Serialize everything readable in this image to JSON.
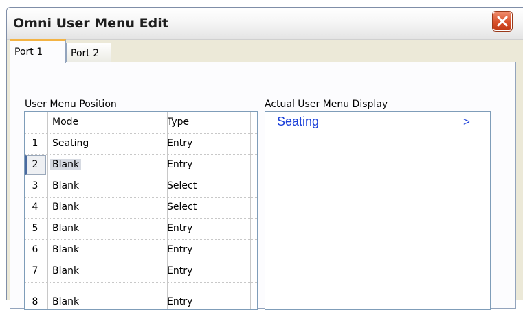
{
  "window": {
    "title": "Omni User Menu Edit",
    "close_icon": "close-x-icon"
  },
  "tabs": [
    {
      "label": "Port 1",
      "active": true
    },
    {
      "label": "Port 2",
      "active": false
    }
  ],
  "left_panel": {
    "label": "User Menu Position",
    "columns": {
      "mode": "Mode",
      "type": "Type"
    },
    "rows": [
      {
        "num": "1",
        "mode": "Seating",
        "type": "Entry"
      },
      {
        "num": "2",
        "mode": "Blank",
        "type": "Entry",
        "selected": true
      },
      {
        "num": "3",
        "mode": "Blank",
        "type": "Select"
      },
      {
        "num": "4",
        "mode": "Blank",
        "type": "Select"
      },
      {
        "num": "5",
        "mode": "Blank",
        "type": "Entry"
      },
      {
        "num": "6",
        "mode": "Blank",
        "type": "Entry"
      },
      {
        "num": "7",
        "mode": "Blank",
        "type": "Entry"
      },
      {
        "num": "8",
        "mode": "Blank",
        "type": "Entry"
      }
    ]
  },
  "right_panel": {
    "label": "Actual User Menu Display",
    "items": [
      {
        "text": "Seating",
        "arrow": ">"
      }
    ]
  },
  "colors": {
    "display_text": "#1a3fd9",
    "tab_active_accent": "#f3b344",
    "close_button": "#d8502a"
  }
}
